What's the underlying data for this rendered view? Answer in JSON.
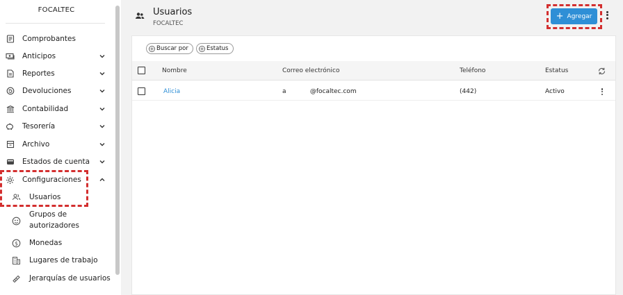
{
  "sidebar": {
    "brand": "FOCALTEC",
    "items": [
      {
        "label": "Comprobantes",
        "icon": "receipt-icon",
        "chevron": ""
      },
      {
        "label": "Anticipos",
        "icon": "payments-icon",
        "chevron": "down"
      },
      {
        "label": "Reportes",
        "icon": "report-icon",
        "chevron": "down"
      },
      {
        "label": "Devoluciones",
        "icon": "return-icon",
        "chevron": "down"
      },
      {
        "label": "Contabilidad",
        "icon": "bank-icon",
        "chevron": "down"
      },
      {
        "label": "Tesorería",
        "icon": "piggy-bank-icon",
        "chevron": "down"
      },
      {
        "label": "Archivo",
        "icon": "archive-icon",
        "chevron": "down"
      },
      {
        "label": "Estados de cuenta",
        "icon": "wallet-icon",
        "chevron": "down"
      },
      {
        "label": "Configuraciones",
        "icon": "gear-icon",
        "chevron": "up"
      }
    ],
    "sub_items": [
      {
        "label": "Usuarios",
        "icon": "users-icon"
      },
      {
        "label": "Grupos de",
        "label2": "autorizadores",
        "icon": "group-face-icon"
      },
      {
        "label": "Monedas",
        "icon": "currency-icon"
      },
      {
        "label": "Lugares de trabajo",
        "icon": "building-icon"
      },
      {
        "label": "Jerarquías de usuarios",
        "icon": "hierarchy-icon"
      }
    ]
  },
  "header": {
    "title": "Usuarios",
    "subtitle": "FOCALTEC",
    "add_label": "Agregar"
  },
  "filters": [
    {
      "label": "Buscar por"
    },
    {
      "label": "Estatus"
    }
  ],
  "table": {
    "columns": [
      "Nombre",
      "Correo electrónico",
      "Teléfono",
      "Estatus"
    ],
    "rows": [
      {
        "nombre": "Alicia",
        "correo": "a            @focaltec.com",
        "telefono": "(442)",
        "estatus": "Activo"
      }
    ]
  },
  "colors": {
    "accent": "#2f8fd6",
    "highlight": "#d32f2f",
    "link": "#2f8fd6"
  }
}
